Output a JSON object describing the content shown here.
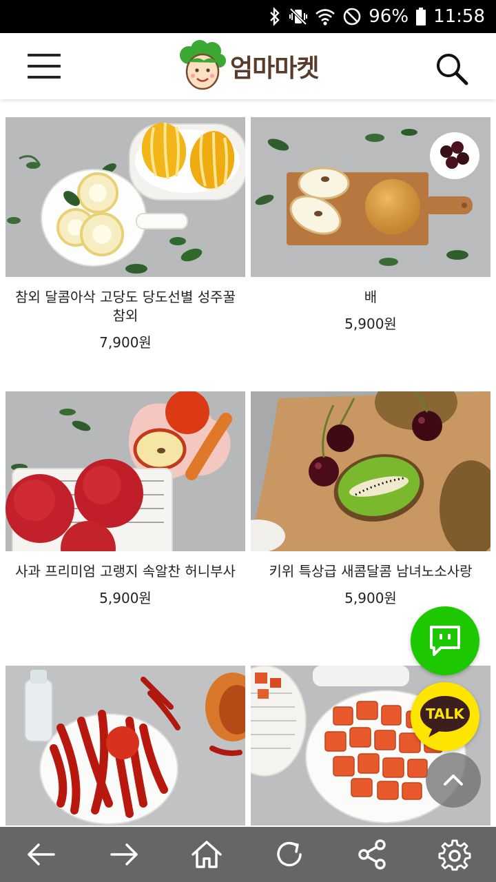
{
  "status_bar": {
    "battery": "96%",
    "time": "11:58",
    "icons": [
      "bluetooth-icon",
      "vibrate-icon",
      "wifi-icon",
      "do-not-disturb-icon",
      "battery-icon"
    ]
  },
  "header": {
    "brand": "엄마마켓",
    "menu_icon": "hamburger-icon",
    "search_icon": "search-icon"
  },
  "products": [
    {
      "name": "참외 달콤아삭 고당도 당도선별 성주꿀참외",
      "price": "7,900원",
      "image": "korean-melon-photo"
    },
    {
      "name": "배",
      "price": "5,900원",
      "image": "pear-photo"
    },
    {
      "name": "사과 프리미엄 고랭지 속알찬 허니부사",
      "price": "5,900원",
      "image": "apple-photo"
    },
    {
      "name": "키위 특상급 새콤달콤 남녀노소사랑",
      "price": "5,900원",
      "image": "kiwi-photo"
    },
    {
      "name": "",
      "price": "",
      "image": "red-pepper-photo"
    },
    {
      "name": "",
      "price": "",
      "image": "radish-kimchi-photo"
    }
  ],
  "floating": {
    "chat_icon": "chat-bubble-icon",
    "talk_label": "TALK",
    "top_icon": "chevron-up-icon"
  },
  "bottom_nav": {
    "items": [
      "back-arrow-icon",
      "forward-arrow-icon",
      "home-icon",
      "refresh-icon",
      "share-icon",
      "settings-icon"
    ]
  },
  "colors": {
    "chat_green": "#1ec800",
    "talk_yellow": "#fee500",
    "nav_gray": "#666666"
  }
}
